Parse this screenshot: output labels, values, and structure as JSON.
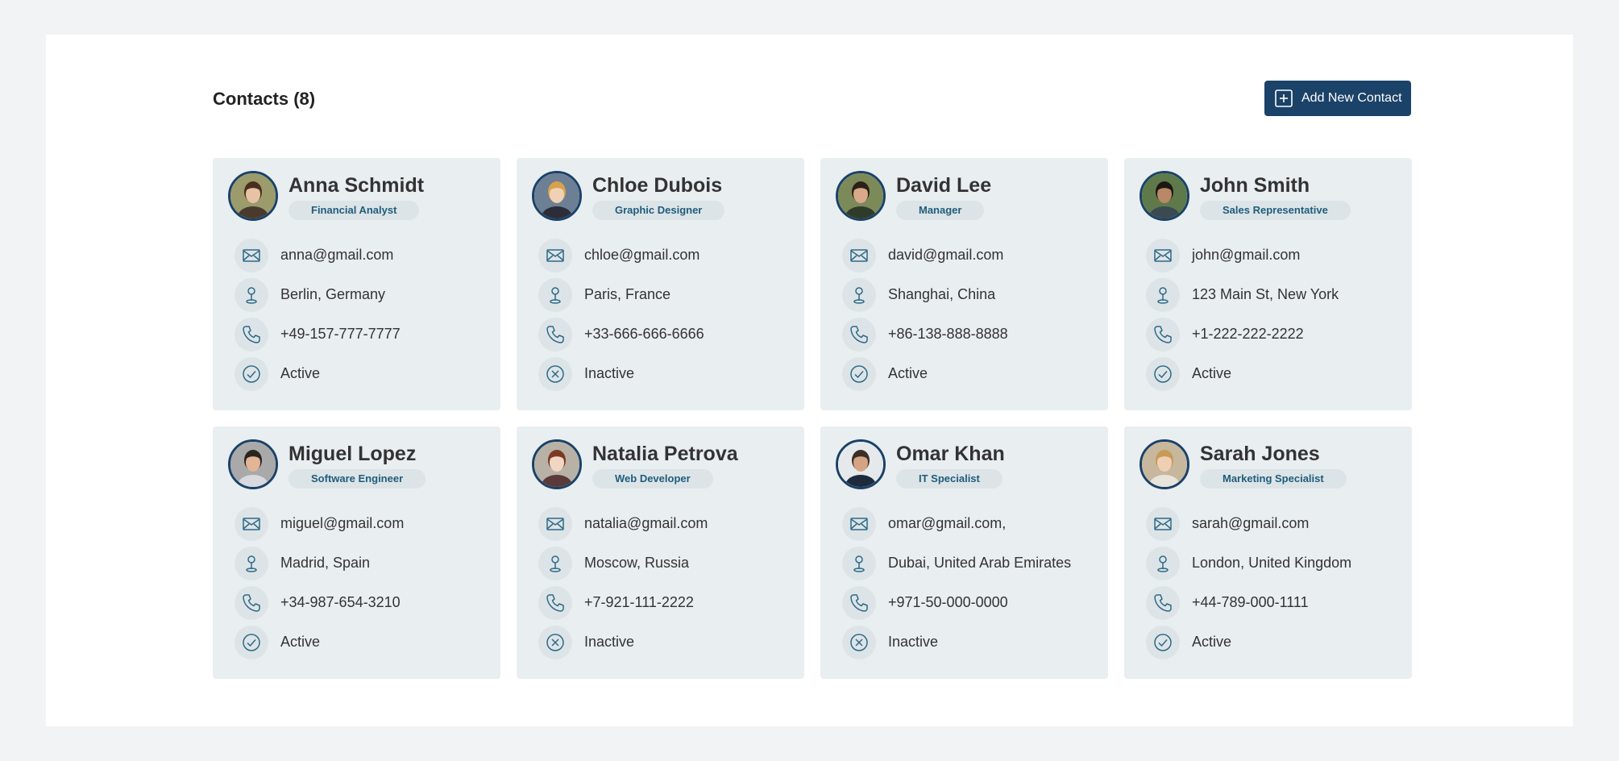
{
  "header": {
    "title": "Contacts (8)",
    "add_button_label": "Add New Contact"
  },
  "colors": {
    "accent": "#1b4268",
    "card_bg": "#e9eef0",
    "badge_text": "#1e5d7c"
  },
  "contacts": [
    {
      "name": "Anna Schmidt",
      "role": "Financial Analyst",
      "email": "anna@gmail.com",
      "location": "Berlin, Germany",
      "phone": "+49-157-777-7777",
      "status": "Active"
    },
    {
      "name": "Chloe Dubois",
      "role": "Graphic Designer",
      "email": "chloe@gmail.com",
      "location": "Paris, France",
      "phone": "+33-666-666-6666",
      "status": "Inactive"
    },
    {
      "name": "David Lee",
      "role": "Manager",
      "email": "david@gmail.com",
      "location": "Shanghai, China",
      "phone": "+86-138-888-8888",
      "status": "Active"
    },
    {
      "name": "John Smith",
      "role": "Sales Representative",
      "email": "john@gmail.com",
      "location": "123 Main St, New York",
      "phone": "+1-222-222-2222",
      "status": "Active"
    },
    {
      "name": "Miguel Lopez",
      "role": "Software Engineer",
      "email": "miguel@gmail.com",
      "location": "Madrid, Spain",
      "phone": "+34-987-654-3210",
      "status": "Active"
    },
    {
      "name": "Natalia Petrova",
      "role": "Web Developer",
      "email": "natalia@gmail.com",
      "location": "Moscow, Russia",
      "phone": "+7-921-111-2222",
      "status": "Inactive"
    },
    {
      "name": "Omar Khan",
      "role": "IT Specialist",
      "email": "omar@gmail.com,",
      "location": "Dubai, United Arab Emirates",
      "phone": "+971-50-000-0000",
      "status": "Inactive"
    },
    {
      "name": "Sarah Jones",
      "role": "Marketing Specialist",
      "email": "sarah@gmail.com",
      "location": "London, United Kingdom",
      "phone": "+44-789-000-1111",
      "status": "Active"
    }
  ],
  "icons": {
    "add": "plus-square-icon",
    "email": "envelope-icon",
    "location": "location-pin-icon",
    "phone": "phone-icon",
    "active": "check-circle-icon",
    "inactive": "x-circle-icon",
    "avatar": "avatar-photo"
  }
}
